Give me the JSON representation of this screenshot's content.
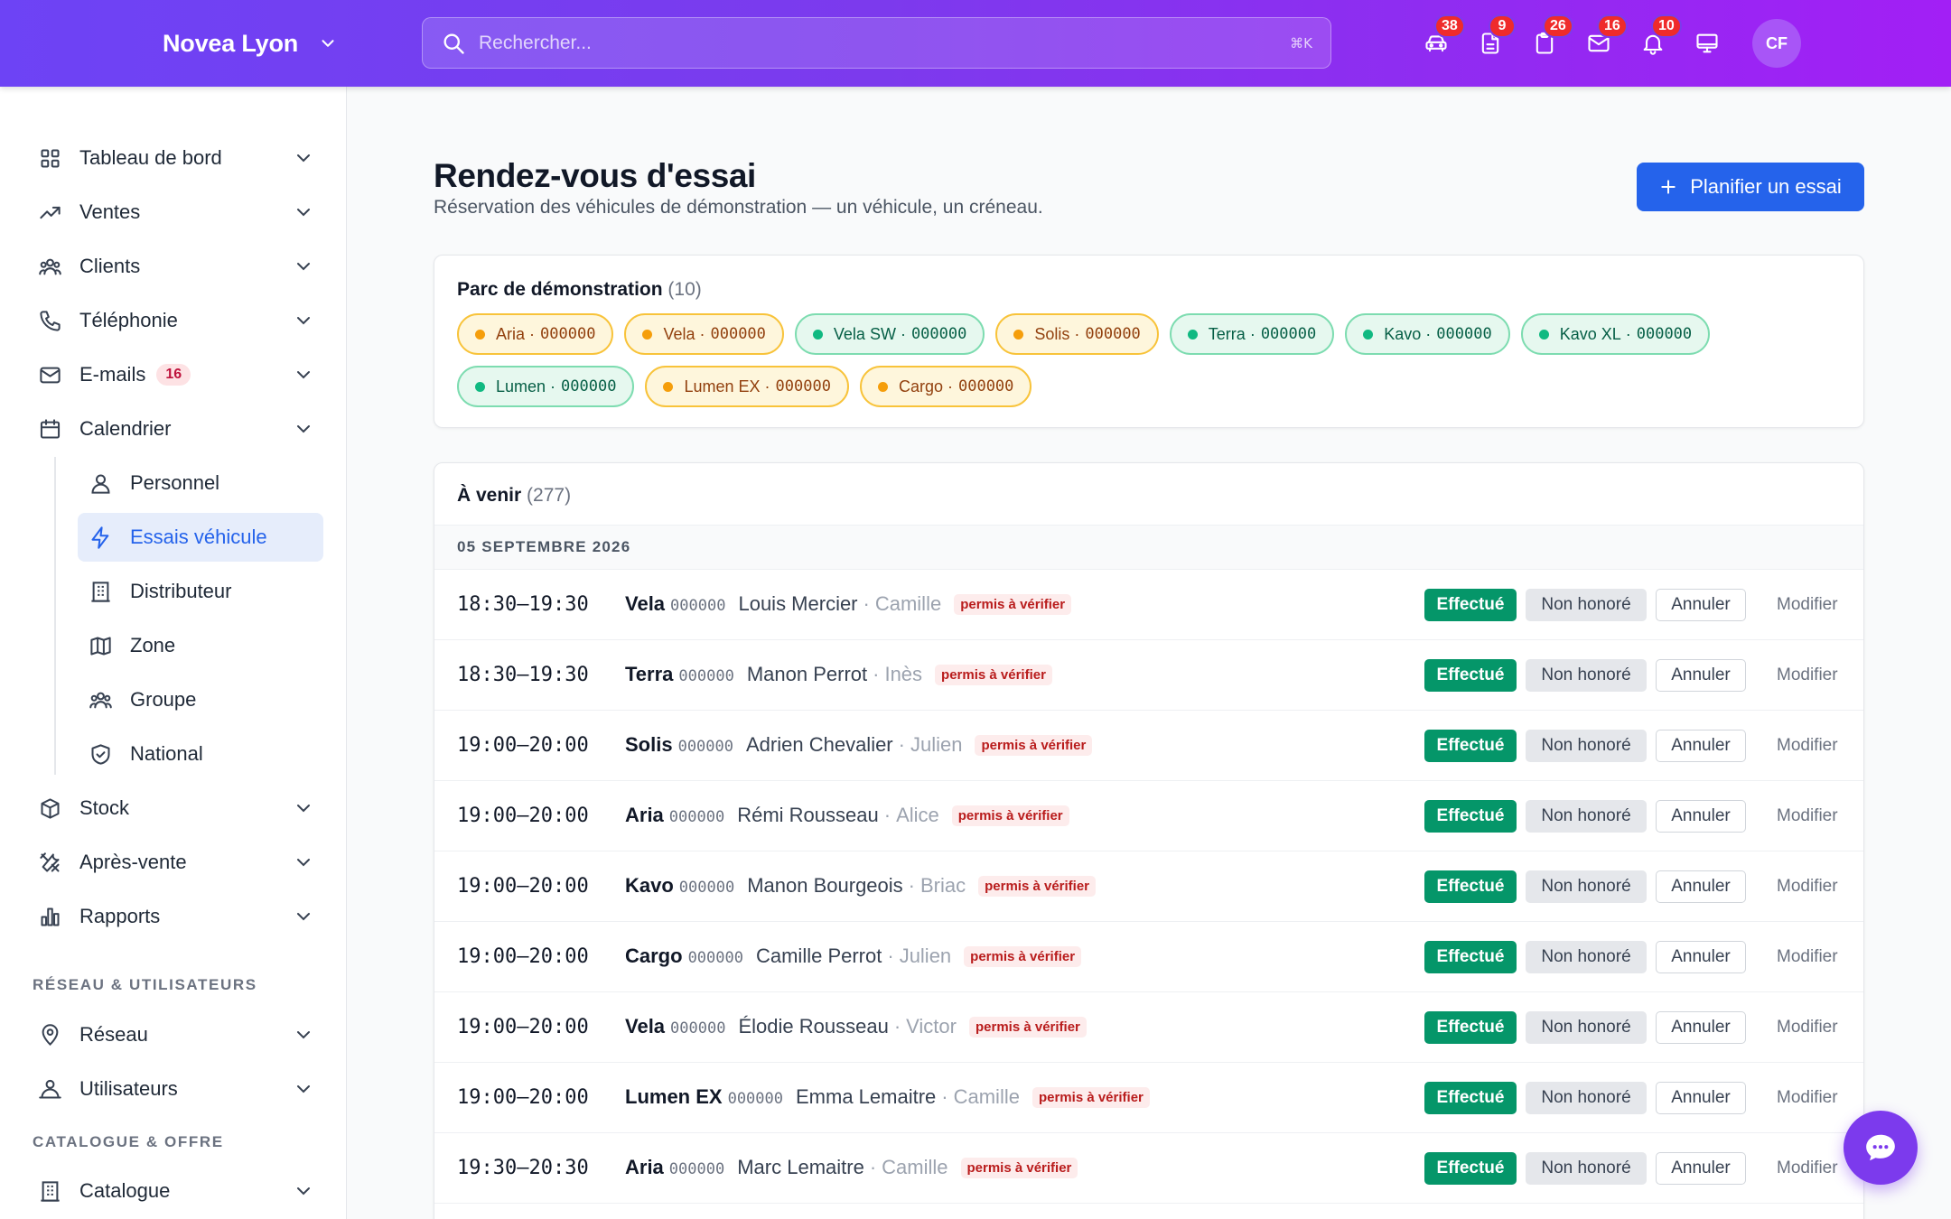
{
  "header": {
    "brand": "Novea Lyon",
    "search_placeholder": "Rechercher...",
    "search_shortcut": "⌘K",
    "icons": [
      {
        "name": "car-icon",
        "badge": "38"
      },
      {
        "name": "document-icon",
        "badge": "9"
      },
      {
        "name": "clipboard-icon",
        "badge": "26"
      },
      {
        "name": "mail-icon",
        "badge": "16"
      },
      {
        "name": "bell-icon",
        "badge": "10"
      },
      {
        "name": "monitor-icon",
        "badge": ""
      }
    ],
    "avatar_initials": "CF"
  },
  "sidebar": {
    "items": [
      {
        "label": "Tableau de bord",
        "icon": "dashboard-icon"
      },
      {
        "label": "Ventes",
        "icon": "trending-up-icon"
      },
      {
        "label": "Clients",
        "icon": "users-icon"
      },
      {
        "label": "Téléphonie",
        "icon": "phone-icon"
      },
      {
        "label": "E-mails",
        "icon": "mail-icon",
        "count": "16"
      },
      {
        "label": "Calendrier",
        "icon": "calendar-icon"
      }
    ],
    "sub_items": [
      {
        "label": "Personnel",
        "icon": "user-icon"
      },
      {
        "label": "Essais véhicule",
        "icon": "bolt-icon",
        "active": true
      },
      {
        "label": "Distributeur",
        "icon": "building-icon"
      },
      {
        "label": "Zone",
        "icon": "map-icon"
      },
      {
        "label": "Groupe",
        "icon": "group-icon"
      },
      {
        "label": "National",
        "icon": "shield-icon"
      }
    ],
    "items_after": [
      {
        "label": "Stock",
        "icon": "box-icon"
      },
      {
        "label": "Après-vente",
        "icon": "tools-icon"
      },
      {
        "label": "Rapports",
        "icon": "chart-icon"
      }
    ],
    "section_network": "RÉSEAU & UTILISATEURS",
    "network_items": [
      {
        "label": "Réseau",
        "icon": "location-icon"
      },
      {
        "label": "Utilisateurs",
        "icon": "user-cog-icon"
      }
    ],
    "section_catalog": "CATALOGUE & OFFRE",
    "catalog_items": [
      {
        "label": "Catalogue",
        "icon": "building-icon"
      }
    ]
  },
  "page": {
    "title": "Rendez-vous d'essai",
    "subtitle": "Réservation des véhicules de démonstration — un véhicule, un créneau.",
    "primary_button": "Planifier un essai"
  },
  "fleet": {
    "title": "Parc de démonstration",
    "count": "(10)",
    "vehicles": [
      {
        "name": "Aria",
        "plate": "000000",
        "status": "amber"
      },
      {
        "name": "Vela",
        "plate": "000000",
        "status": "amber"
      },
      {
        "name": "Vela SW",
        "plate": "000000",
        "status": "green"
      },
      {
        "name": "Solis",
        "plate": "000000",
        "status": "amber"
      },
      {
        "name": "Terra",
        "plate": "000000",
        "status": "green"
      },
      {
        "name": "Kavo",
        "plate": "000000",
        "status": "green"
      },
      {
        "name": "Kavo XL",
        "plate": "000000",
        "status": "green"
      },
      {
        "name": "Lumen",
        "plate": "000000",
        "status": "green"
      },
      {
        "name": "Lumen EX",
        "plate": "000000",
        "status": "amber"
      },
      {
        "name": "Cargo",
        "plate": "000000",
        "status": "amber"
      }
    ]
  },
  "upcoming": {
    "title": "À venir",
    "count": "(277)",
    "date": "05 SEPTEMBRE 2026",
    "labels": {
      "done": "Effectué",
      "noshow": "Non honoré",
      "cancel": "Annuler",
      "edit": "Modifier",
      "warning": "permis à vérifier"
    },
    "rows": [
      {
        "time": "18:30–19:30",
        "vehicle": "Vela",
        "plate": "000000",
        "customer": "Louis Mercier",
        "seller": "Camille"
      },
      {
        "time": "18:30–19:30",
        "vehicle": "Terra",
        "plate": "000000",
        "customer": "Manon Perrot",
        "seller": "Inès"
      },
      {
        "time": "19:00–20:00",
        "vehicle": "Solis",
        "plate": "000000",
        "customer": "Adrien Chevalier",
        "seller": "Julien"
      },
      {
        "time": "19:00–20:00",
        "vehicle": "Aria",
        "plate": "000000",
        "customer": "Rémi Rousseau",
        "seller": "Alice"
      },
      {
        "time": "19:00–20:00",
        "vehicle": "Kavo",
        "plate": "000000",
        "customer": "Manon Bourgeois",
        "seller": "Briac"
      },
      {
        "time": "19:00–20:00",
        "vehicle": "Cargo",
        "plate": "000000",
        "customer": "Camille Perrot",
        "seller": "Julien"
      },
      {
        "time": "19:00–20:00",
        "vehicle": "Vela",
        "plate": "000000",
        "customer": "Élodie Rousseau",
        "seller": "Victor"
      },
      {
        "time": "19:00–20:00",
        "vehicle": "Lumen EX",
        "plate": "000000",
        "customer": "Emma Lemaitre",
        "seller": "Camille"
      },
      {
        "time": "19:30–20:30",
        "vehicle": "Aria",
        "plate": "000000",
        "customer": "Marc Lemaitre",
        "seller": "Camille"
      }
    ]
  }
}
